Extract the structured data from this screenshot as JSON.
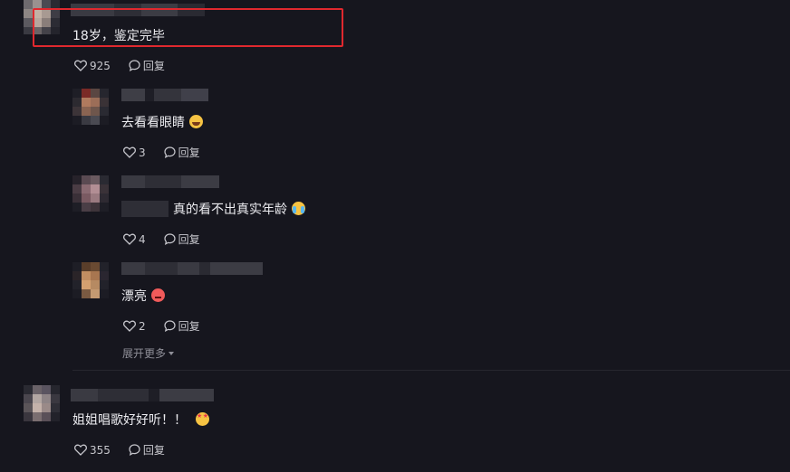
{
  "comments": [
    {
      "text": "18岁，鉴定完毕",
      "likes": "925",
      "reply_label": "回复"
    },
    {
      "text": "去看看眼睛",
      "emoji": "laughing-tears-emoji",
      "likes": "3",
      "reply_label": "回复"
    },
    {
      "text": "真的看不出真实年龄",
      "emoji": "crying-emoji",
      "likes": "4",
      "reply_label": "回复"
    },
    {
      "text": "漂亮",
      "emoji": "angry-emoji",
      "likes": "2",
      "reply_label": "回复"
    },
    {
      "text": "姐姐唱歌好好听！！",
      "emoji": "star-struck-emoji",
      "likes": "355",
      "reply_label": "回复"
    }
  ],
  "expand_label": "展开更多",
  "colors": {
    "background": "#16161e",
    "text": "#ececf0",
    "meta": "#c7c7cd",
    "highlight": "#e0282e"
  }
}
